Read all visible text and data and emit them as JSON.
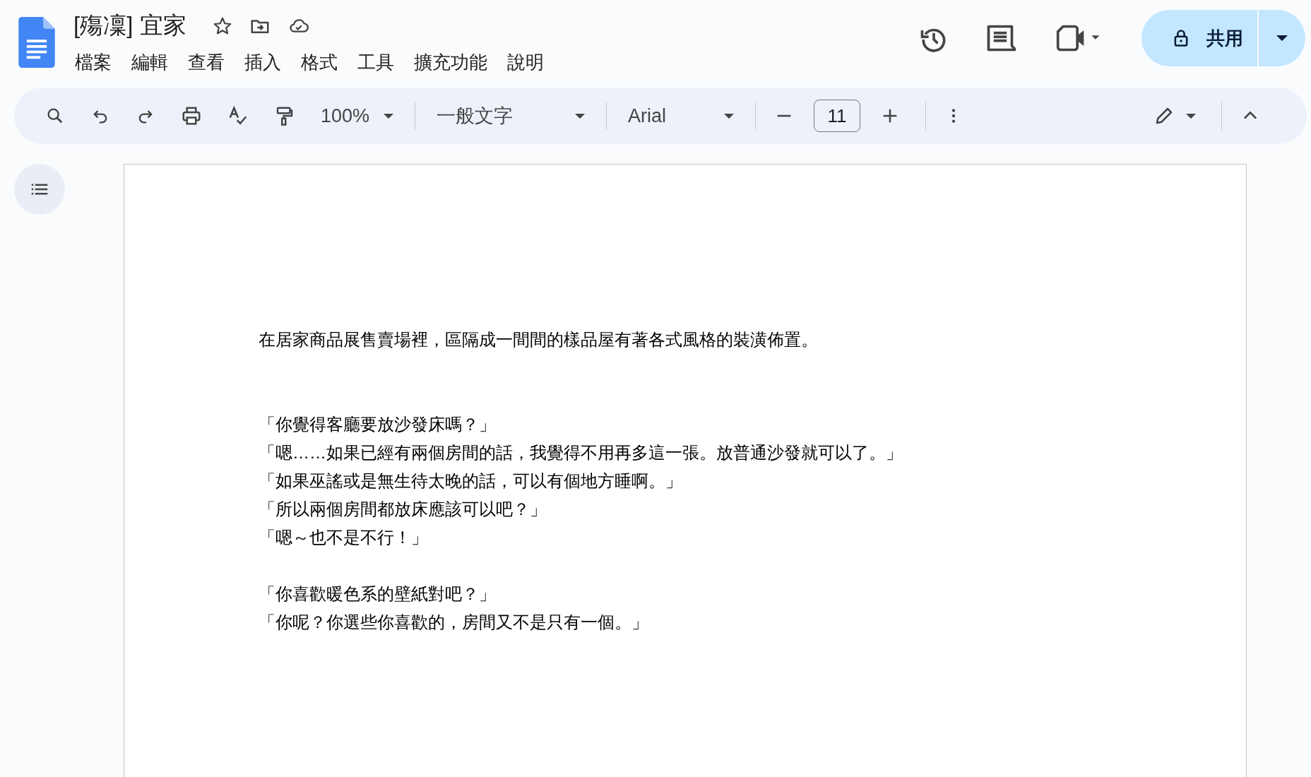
{
  "document": {
    "title": "[殤凜] 宜家",
    "starred": false
  },
  "menu": [
    "檔案",
    "編輯",
    "查看",
    "插入",
    "格式",
    "工具",
    "擴充功能",
    "說明"
  ],
  "share_button": {
    "label": "共用"
  },
  "toolbar": {
    "zoom": "100%",
    "style": "一般文字",
    "font": "Arial",
    "font_size": "11"
  },
  "body": [
    {
      "lines": [
        "在居家商品展售賣場裡，區隔成一間間的樣品屋有著各式風格的裝潢佈置。"
      ]
    },
    {
      "lines": [
        "「你覺得客廳要放沙發床嗎？」",
        "「嗯……如果已經有兩個房間的話，我覺得不用再多這一張。放普通沙發就可以了。」",
        "「如果巫謠或是無生待太晚的話，可以有個地方睡啊。」",
        "「所以兩個房間都放床應該可以吧？」",
        "「嗯～也不是不行！」"
      ]
    },
    {
      "lines": [
        "「你喜歡暖色系的壁紙對吧？」",
        "「你呢？你選些你喜歡的，房間又不是只有一個。」"
      ]
    }
  ]
}
